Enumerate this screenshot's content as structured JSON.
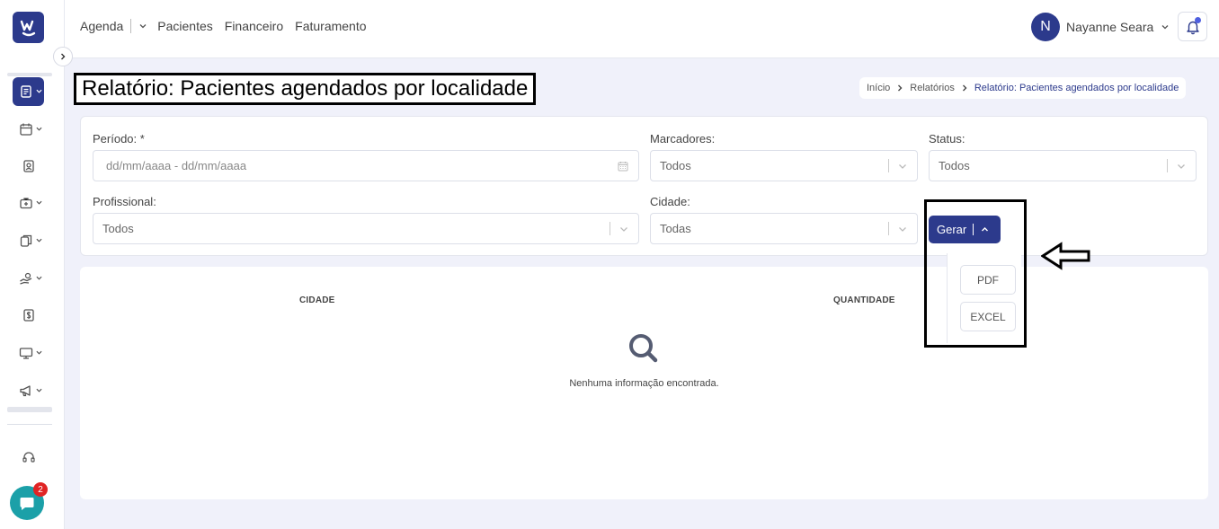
{
  "topnav": {
    "items": [
      "Agenda",
      "Pacientes",
      "Financeiro",
      "Faturamento"
    ]
  },
  "user": {
    "initial": "N",
    "name": "Nayanne Seara"
  },
  "page": {
    "title": "Relatório: Pacientes agendados por localidade"
  },
  "breadcrumb": {
    "items": [
      "Início",
      "Relatórios",
      "Relatório: Pacientes agendados por localidade"
    ]
  },
  "filters": {
    "periodo": {
      "label": "Período: *",
      "placeholder": "dd/mm/aaaa - dd/mm/aaaa"
    },
    "marcadores": {
      "label": "Marcadores:",
      "value": "Todos"
    },
    "status": {
      "label": "Status:",
      "value": "Todos"
    },
    "profissional": {
      "label": "Profissional:",
      "value": "Todos"
    },
    "cidade": {
      "label": "Cidade:",
      "value": "Todas"
    }
  },
  "gerar": {
    "label": "Gerar",
    "options": [
      "PDF",
      "EXCEL"
    ]
  },
  "results": {
    "columns": [
      "CIDADE",
      "QUANTIDADE"
    ],
    "empty_message": "Nenhuma informação encontrada."
  },
  "chat": {
    "badge_count": "2"
  },
  "colors": {
    "primary": "#2c3a8c",
    "chat": "#1ba0a8",
    "badge": "#e02424"
  },
  "icons": [
    "logo-icon",
    "chevron-right-icon",
    "report-icon",
    "calendar-icon",
    "patient-card-icon",
    "medical-case-icon",
    "documents-icon",
    "hand-coin-icon",
    "dollar-doc-icon",
    "monitor-icon",
    "megaphone-icon",
    "headset-icon",
    "chat-icon",
    "bell-icon",
    "search-icon",
    "back-arrow-icon"
  ]
}
